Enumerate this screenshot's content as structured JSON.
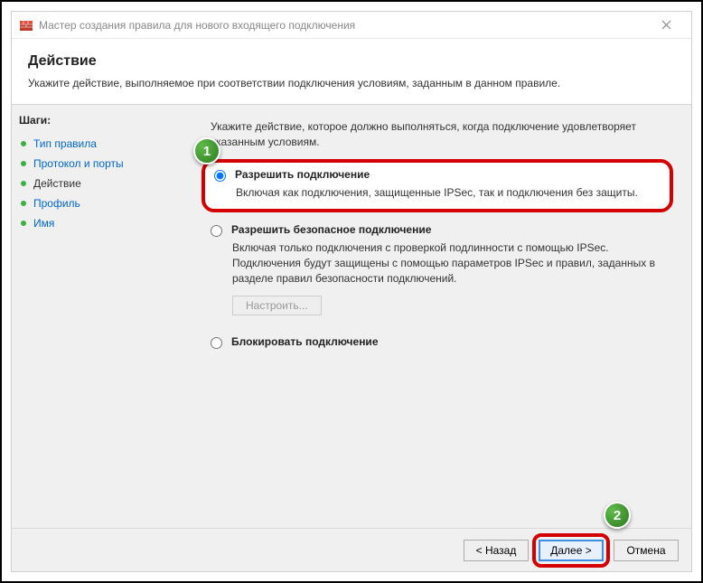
{
  "window": {
    "title": "Мастер создания правила для нового входящего подключения"
  },
  "header": {
    "title": "Действие",
    "subtitle": "Укажите действие, выполняемое при соответствии подключения условиям, заданным в данном правиле."
  },
  "sidebar": {
    "steps_label": "Шаги:",
    "items": [
      {
        "label": "Тип правила",
        "state": "link"
      },
      {
        "label": "Протокол и порты",
        "state": "link"
      },
      {
        "label": "Действие",
        "state": "current"
      },
      {
        "label": "Профиль",
        "state": "link"
      },
      {
        "label": "Имя",
        "state": "link"
      }
    ]
  },
  "content": {
    "intro": "Укажите действие, которое должно выполняться, когда подключение удовлетворяет указанным условиям.",
    "options": [
      {
        "title": "Разрешить подключение",
        "desc": "Включая как подключения, защищенные IPSec, так и подключения без защиты.",
        "selected": true,
        "highlighted": true
      },
      {
        "title": "Разрешить безопасное подключение",
        "desc": "Включая только подключения с проверкой подлинности с помощью IPSec. Подключения будут защищены с помощью параметров IPSec и правил, заданных в разделе правил безопасности подключений.",
        "selected": false,
        "configure_label": "Настроить..."
      },
      {
        "title": "Блокировать подключение",
        "desc": "",
        "selected": false
      }
    ]
  },
  "footer": {
    "back": "< Назад",
    "next": "Далее >",
    "cancel": "Отмена"
  },
  "annotations": {
    "a1": "1",
    "a2": "2"
  }
}
